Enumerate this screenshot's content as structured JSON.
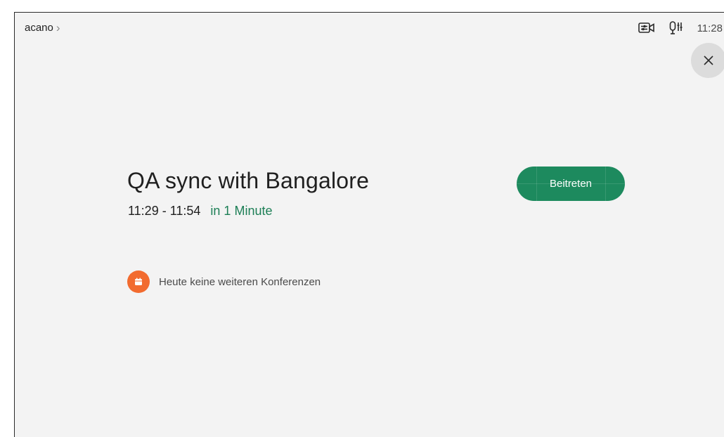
{
  "header": {
    "room_name": "acano",
    "clock": "11:28"
  },
  "icons": {
    "camera_controls": "camera-controls-icon",
    "mic_settings": "microphone-settings-icon",
    "close": "close-icon",
    "calendar": "calendar-icon",
    "chevron": "chevron-right-icon"
  },
  "meeting": {
    "title": "QA sync with Bangalore",
    "time_range": "11:29 - 11:54",
    "starts_in": "in 1 Minute",
    "join_label": "Beitreten"
  },
  "agenda": {
    "empty_message": "Heute keine weiteren Konferenzen"
  },
  "colors": {
    "join_button": "#1d8a5e",
    "countdown_text": "#1d7f56",
    "calendar_badge": "#f26b2f",
    "background": "#f3f3f3"
  }
}
